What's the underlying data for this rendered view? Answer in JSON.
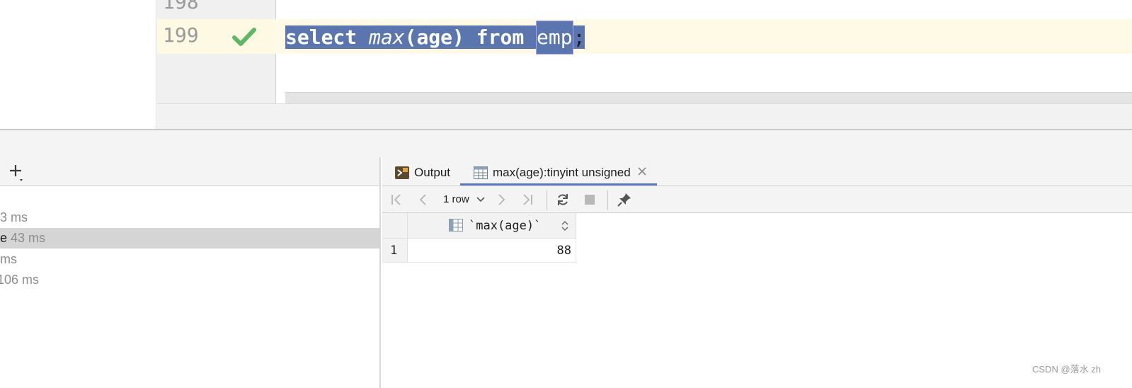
{
  "editor": {
    "lines": [
      {
        "number": "198"
      },
      {
        "number": "199",
        "status": "check-icon"
      }
    ],
    "code": {
      "kw_select": "select",
      "fn_max": "max",
      "args": "(age)",
      "kw_from": "from",
      "table": "emp",
      "terminator": ";"
    }
  },
  "history": {
    "items": [
      {
        "name": "",
        "time": "3 ms",
        "selected": false
      },
      {
        "name": "e",
        "time": "43 ms",
        "selected": true
      },
      {
        "name": "",
        "time": "ms",
        "selected": false
      },
      {
        "name": "",
        "time": "106 ms",
        "selected": false
      }
    ]
  },
  "tabs": {
    "output_label": "Output",
    "result_label": "max(age):tinyint unsigned"
  },
  "grid_toolbar": {
    "rows_label": "1 row"
  },
  "result": {
    "column_header": "`max(age)`",
    "rows": [
      {
        "num": "1",
        "value": "88"
      }
    ]
  },
  "watermark": "CSDN @落水 zh",
  "colors": {
    "selection": "#5b75ae",
    "current_line": "#fefae5",
    "check": "#5fb865",
    "active_tab_underline": "#5b7dbf"
  }
}
